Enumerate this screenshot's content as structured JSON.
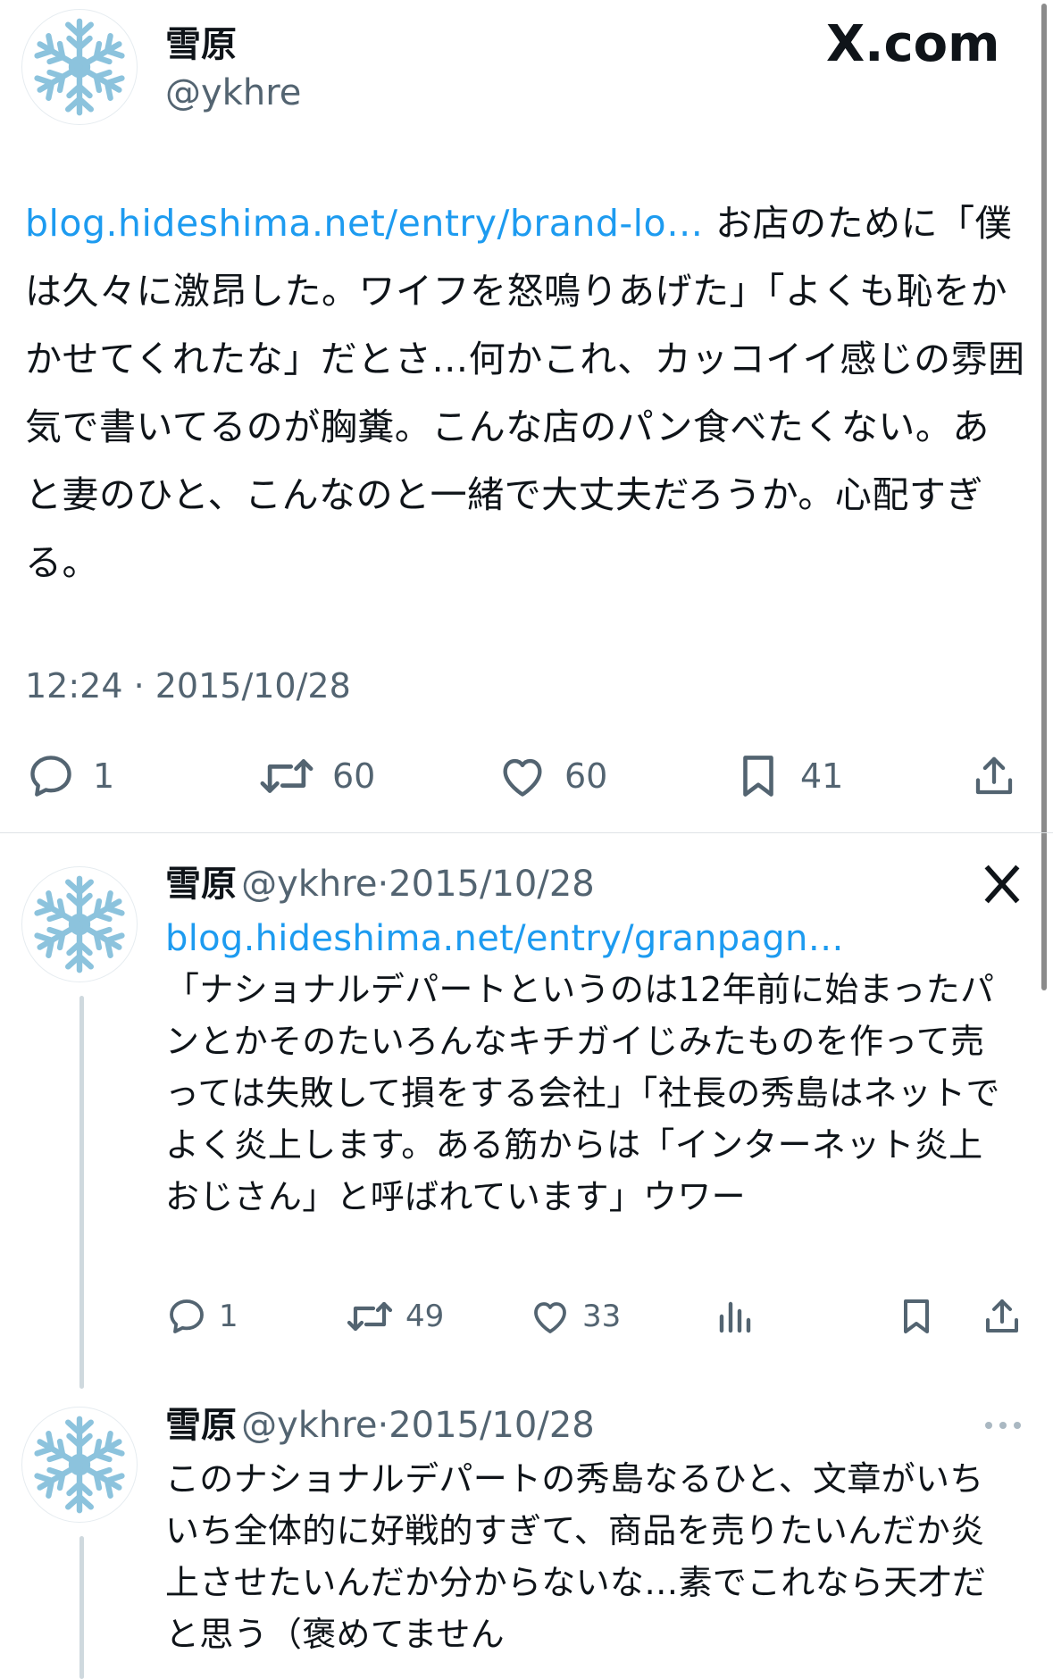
{
  "main_tweet": {
    "display_name": "雪原",
    "handle": "@ykhre",
    "brand": "X.com",
    "link_text": "blog.hideshima.net/entry/brand-lo…",
    "text_line1": " お店のために",
    "text_rest": "「僕は久々に激昂した。ワイフを怒鳴りあげた」「よくも恥をかかせてくれたな」だとさ…何かこれ、カッコイイ感じの雰囲気で書いてるのが胸糞。こんな店のパン食べたくない。あと妻のひと、こんなのと一緒で大丈夫だろうか。心配すぎる。",
    "timestamp": "12:24 · 2015/10/28",
    "replies": "1",
    "retweets": "60",
    "likes": "60",
    "bookmarks": "41"
  },
  "reply1": {
    "display_name": "雪原",
    "handle": "@ykhre",
    "separator": "·",
    "date": "2015/10/28",
    "link_text": "blog.hideshima.net/entry/granpagn…",
    "text": "「ナショナルデパートというのは12年前に始まったパンとかそのたいろんなキチガイじみたものを作って売っては失敗して損をする会社」「社長の秀島はネットでよく炎上します。ある筋からは「インターネット炎上おじさん」と呼ばれています」ウワー",
    "replies": "1",
    "retweets": "49",
    "likes": "33"
  },
  "reply2": {
    "display_name": "雪原",
    "handle": "@ykhre",
    "separator": "·",
    "date": "2015/10/28",
    "text": "このナショナルデパートの秀島なるひと、文章がいちいち全体的に好戦的すぎて、商品を売りたいんだか炎上させたいんだか分からないな…素でこれなら天才だと思う（褒めてません"
  },
  "colors": {
    "link": "#1d9bf0",
    "secondary": "#536471",
    "text": "#0f1419",
    "avatar_snowflake": "#8cc3dd"
  },
  "icons": [
    "snowflake-avatar",
    "x-logo-icon",
    "reply-icon",
    "retweet-icon",
    "like-icon",
    "bookmark-icon",
    "share-icon",
    "views-icon",
    "more-icon"
  ]
}
